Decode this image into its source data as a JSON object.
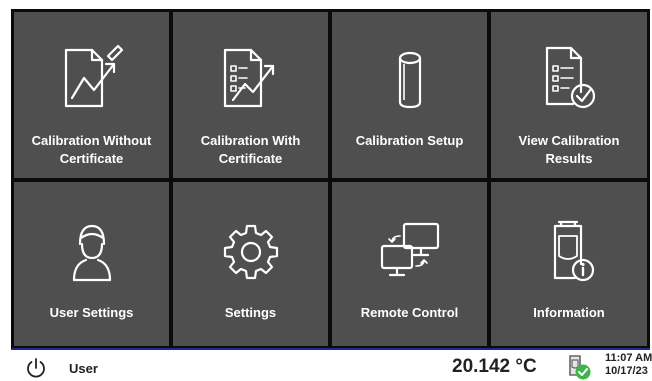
{
  "tiles": [
    {
      "label": "Calibration Without Certificate",
      "icon": "document-chart-pen-icon"
    },
    {
      "label": "Calibration With Certificate",
      "icon": "document-list-chart-icon"
    },
    {
      "label": "Calibration Setup",
      "icon": "cylinder-icon"
    },
    {
      "label": "View Calibration Results",
      "icon": "document-checkmark-icon"
    },
    {
      "label": "User Settings",
      "icon": "user-icon"
    },
    {
      "label": "Settings",
      "icon": "gear-icon"
    },
    {
      "label": "Remote Control",
      "icon": "monitors-sync-icon"
    },
    {
      "label": "Information",
      "icon": "device-info-icon"
    }
  ],
  "status": {
    "user": "User",
    "temperature": "20.142 °C",
    "time": "11:07 AM",
    "date": "10/17/23",
    "power_icon": "power-icon",
    "device_icon": "device-status-icon"
  },
  "colors": {
    "tile": "#4f4f4f",
    "grid": "#0b0b0b",
    "accent_green": "#3cb44b",
    "status_border": "#1f2a8a"
  }
}
